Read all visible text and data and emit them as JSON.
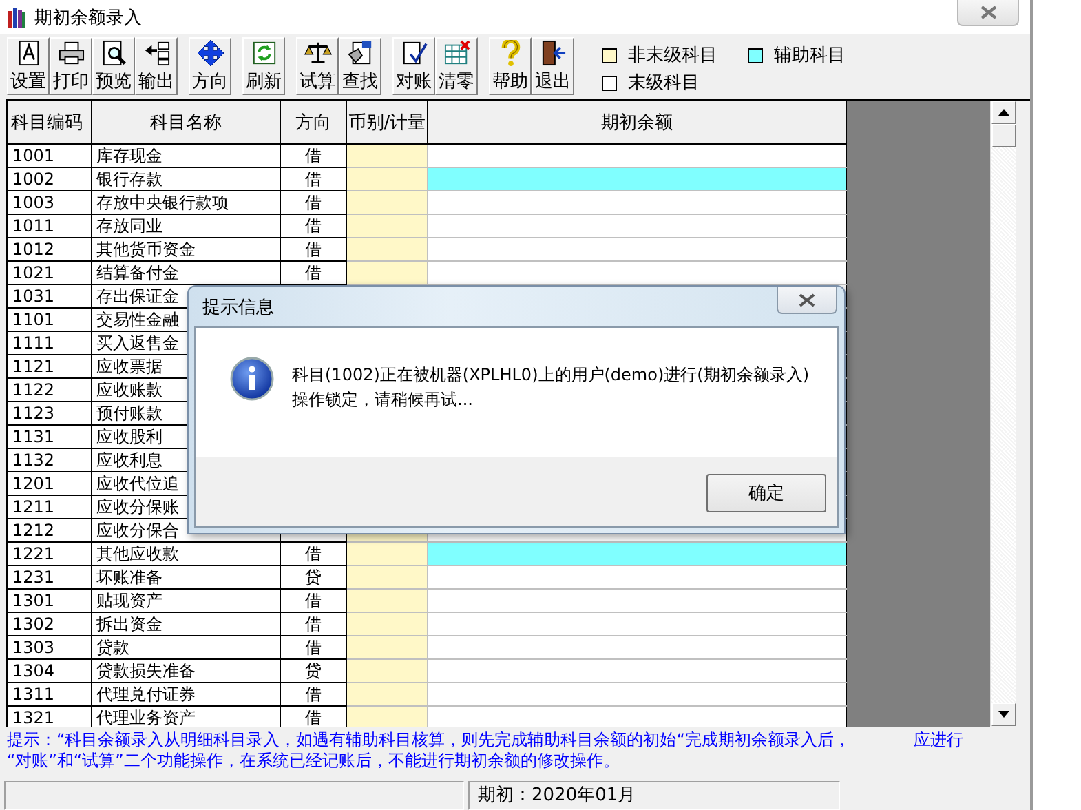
{
  "window": {
    "title": "期初余额录入"
  },
  "toolbar": {
    "groups": [
      [
        {
          "label": "设置"
        },
        {
          "label": "打印"
        },
        {
          "label": "预览"
        },
        {
          "label": "输出"
        }
      ],
      [
        {
          "label": "方向"
        }
      ],
      [
        {
          "label": "刷新"
        }
      ],
      [
        {
          "label": "试算"
        },
        {
          "label": "查找"
        }
      ],
      [
        {
          "label": "对账"
        },
        {
          "label": "清零"
        }
      ],
      [
        {
          "label": "帮助"
        },
        {
          "label": "退出"
        }
      ]
    ]
  },
  "legend": [
    {
      "label": "非末级科目",
      "color": "#fff8c8"
    },
    {
      "label": "辅助科目",
      "color": "#80ffff"
    },
    {
      "label": "末级科目",
      "color": "#ffffff"
    }
  ],
  "grid": {
    "columns": [
      "科目编码",
      "科目名称",
      "方向",
      "币别/计量",
      "期初余额"
    ],
    "rows": [
      {
        "code": "1001",
        "name": "库存现金",
        "direction": "借",
        "auxiliary": false
      },
      {
        "code": "1002",
        "name": "银行存款",
        "direction": "借",
        "auxiliary": true
      },
      {
        "code": "1003",
        "name": "存放中央银行款项",
        "direction": "借",
        "auxiliary": false
      },
      {
        "code": "1011",
        "name": "存放同业",
        "direction": "借",
        "auxiliary": false
      },
      {
        "code": "1012",
        "name": "其他货币资金",
        "direction": "借",
        "auxiliary": false
      },
      {
        "code": "1021",
        "name": "结算备付金",
        "direction": "借",
        "auxiliary": false
      },
      {
        "code": "1031",
        "name": "存出保证金"
      },
      {
        "code": "1101",
        "name": "交易性金融"
      },
      {
        "code": "1111",
        "name": "买入返售金"
      },
      {
        "code": "1121",
        "name": "应收票据"
      },
      {
        "code": "1122",
        "name": "应收账款"
      },
      {
        "code": "1123",
        "name": "预付账款"
      },
      {
        "code": "1131",
        "name": "应收股利"
      },
      {
        "code": "1132",
        "name": "应收利息"
      },
      {
        "code": "1201",
        "name": "应收代位追"
      },
      {
        "code": "1211",
        "name": "应收分保账"
      },
      {
        "code": "1212",
        "name": "应收分保合"
      },
      {
        "code": "1221",
        "name": "其他应收款",
        "direction": "借",
        "auxiliary": true
      },
      {
        "code": "1231",
        "name": "坏账准备",
        "direction": "贷",
        "auxiliary": false
      },
      {
        "code": "1301",
        "name": "贴现资产",
        "direction": "借",
        "auxiliary": false
      },
      {
        "code": "1302",
        "name": "拆出资金",
        "direction": "借",
        "auxiliary": false
      },
      {
        "code": "1303",
        "name": "贷款",
        "direction": "借",
        "auxiliary": false
      },
      {
        "code": "1304",
        "name": "贷款损失准备",
        "direction": "贷",
        "auxiliary": false
      },
      {
        "code": "1311",
        "name": "代理兑付证券",
        "direction": "借",
        "auxiliary": false
      },
      {
        "code": "1321",
        "name": "代理业务资产",
        "direction": "借",
        "auxiliary": false
      }
    ]
  },
  "hint": [
    "提示：“科目余额录入从明细科目录入，如遇有辅助科目核算，则先完成辅助科目余额的初始“完成期初余额录入后，",
    "应进行",
    "“对账”和“试算”二个功能操作，在系统已经记账后，不能进行期初余额的修改操作。"
  ],
  "status_bar": {
    "period": "期初：2020年01月"
  },
  "dialog": {
    "title": "提示信息",
    "message": [
      "科目(1002)正在被机器(XPLHL0)上的用户(demo)进行(期初余额录入)",
      "操作锁定，请稍候再试..."
    ],
    "button": "确定"
  }
}
